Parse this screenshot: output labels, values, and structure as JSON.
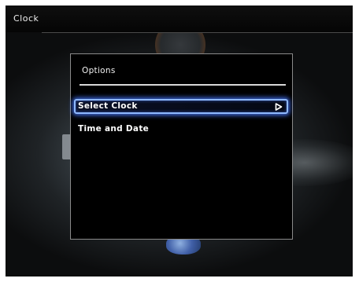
{
  "header": {
    "title": "Clock"
  },
  "options_panel": {
    "title": "Options",
    "items": [
      {
        "label": "Select Clock",
        "selected": true,
        "icon": "play-arrow-icon"
      },
      {
        "label": "Time and Date",
        "selected": false
      }
    ]
  },
  "colors": {
    "selection_glow": "#4678ff",
    "panel_background": "#000000",
    "text": "#ffffff"
  }
}
